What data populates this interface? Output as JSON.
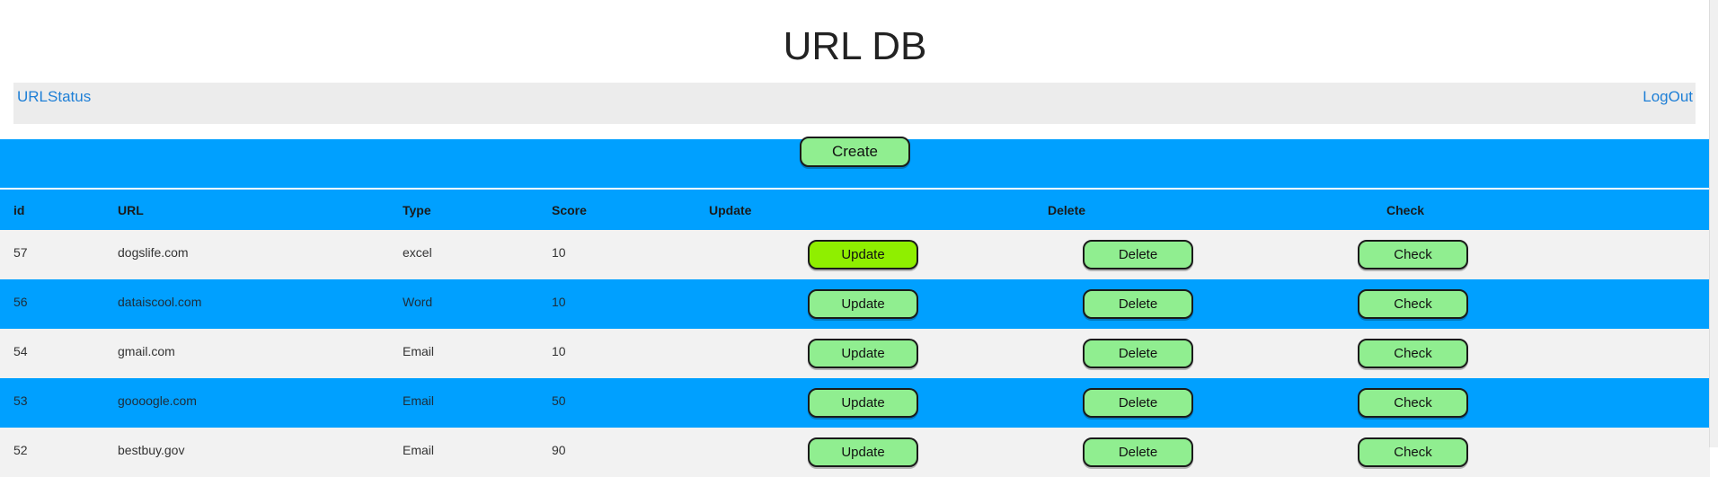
{
  "page": {
    "title": "URL DB"
  },
  "nav": {
    "left_link": "URLStatus",
    "right_link": "LogOut"
  },
  "toolbar": {
    "create_label": "Create"
  },
  "table": {
    "headers": [
      "id",
      "URL",
      "Type",
      "Score",
      "Update",
      "Delete",
      "Check"
    ],
    "rows": [
      {
        "id": "57",
        "url": "dogslife.com",
        "type": "excel",
        "score": "10",
        "update": "Update",
        "delete": "Delete",
        "check": "Check"
      },
      {
        "id": "56",
        "url": "dataiscool.com",
        "type": "Word",
        "score": "10",
        "update": "Update",
        "delete": "Delete",
        "check": "Check"
      },
      {
        "id": "54",
        "url": "gmail.com",
        "type": "Email",
        "score": "10",
        "update": "Update",
        "delete": "Delete",
        "check": "Check"
      },
      {
        "id": "53",
        "url": "goooogle.com",
        "type": "Email",
        "score": "50",
        "update": "Update",
        "delete": "Delete",
        "check": "Check"
      },
      {
        "id": "52",
        "url": "bestbuy.gov",
        "type": "Email",
        "score": "90",
        "update": "Update",
        "delete": "Delete",
        "check": "Check"
      }
    ]
  },
  "colors": {
    "accent_blue": "#00a0ff",
    "button_green": "#90ee90",
    "highlight_green": "#8fef00",
    "link_blue": "#1e7fd6"
  }
}
